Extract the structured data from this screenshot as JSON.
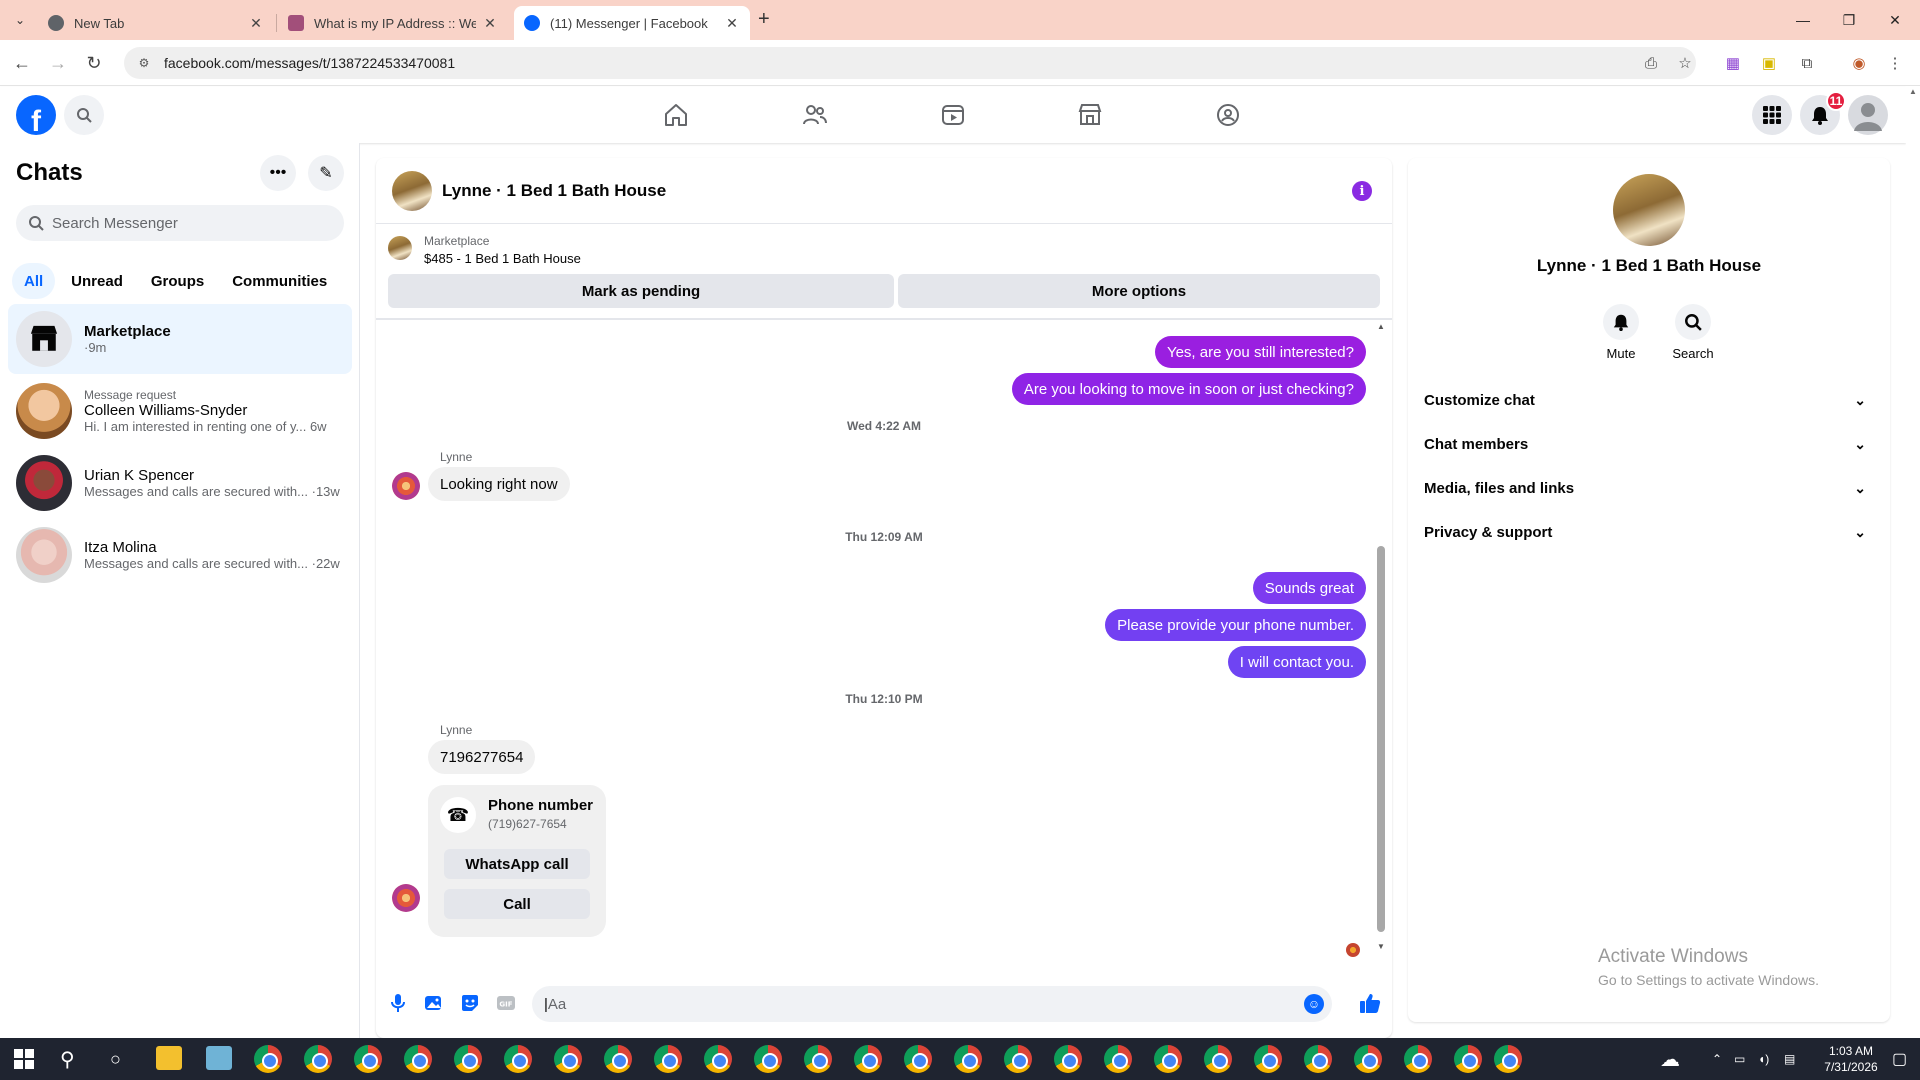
{
  "browser": {
    "tabs": [
      {
        "label": "New Tab",
        "favicon_color": "#5f6368"
      },
      {
        "label": "What is my IP Address :: WebBr",
        "favicon_color": "#a24f7a"
      },
      {
        "label": "(11) Messenger | Facebook",
        "favicon_color": "#0866ff"
      }
    ],
    "url": "facebook.com/messages/t/1387224533470081"
  },
  "fb_header": {
    "logo_letter": "f",
    "notification_count": "11"
  },
  "left": {
    "title": "Chats",
    "search_placeholder": "Search Messenger",
    "filters": [
      "All",
      "Unread",
      "Groups",
      "Communities"
    ],
    "chats": [
      {
        "request": "",
        "name": "Marketplace",
        "snippet": "·9m"
      },
      {
        "request": "Message request",
        "name": "Colleen Williams-Snyder",
        "snippet": "Hi. I am interested in renting one of y...",
        "time": "6w"
      },
      {
        "request": "",
        "name": "Urian K Spencer",
        "snippet": "Messages and calls are secured with...",
        "time": "·13w"
      },
      {
        "request": "",
        "name": "Itza Molina",
        "snippet": "Messages and calls are secured with...",
        "time": "·22w"
      }
    ]
  },
  "conversation": {
    "title": "Lynne · 1 Bed 1 Bath House",
    "marketplace_label": "Marketplace",
    "listing": "$485 - 1 Bed 1 Bath House",
    "mark_pending": "Mark as pending",
    "more_options": "More options",
    "messages": {
      "out1": "Yes, are you still interested?",
      "out2": "Are you looking to move in soon or just checking?",
      "ts1": "Wed 4:22 AM",
      "sender1": "Lynne",
      "in1": "Looking right now",
      "ts2": "Thu 12:09 AM",
      "out3": "Sounds great",
      "out4": "Please provide your phone number.",
      "out5": "I will contact you.",
      "ts3": "Thu 12:10 PM",
      "sender2": "Lynne",
      "in2": "7196277654"
    },
    "phone_card": {
      "title": "Phone number",
      "number": "(719)627-7654",
      "whatsapp": "WhatsApp call",
      "call": "Call"
    },
    "composer_placeholder": "Aa"
  },
  "right": {
    "name": "Lynne · 1 Bed 1 Bath House",
    "mute": "Mute",
    "search": "Search",
    "sections": [
      "Customize chat",
      "Chat members",
      "Media, files and links",
      "Privacy & support"
    ]
  },
  "watermark": {
    "line1": "Activate Windows",
    "line2": "Go to Settings to activate Windows."
  },
  "taskbar": {
    "time": "1:03 AM",
    "date": "7/31/2026"
  },
  "colors": {
    "brand": "#0866ff",
    "bubble_out": "#8a26e8",
    "tab_bar": "#f9d3c8"
  }
}
